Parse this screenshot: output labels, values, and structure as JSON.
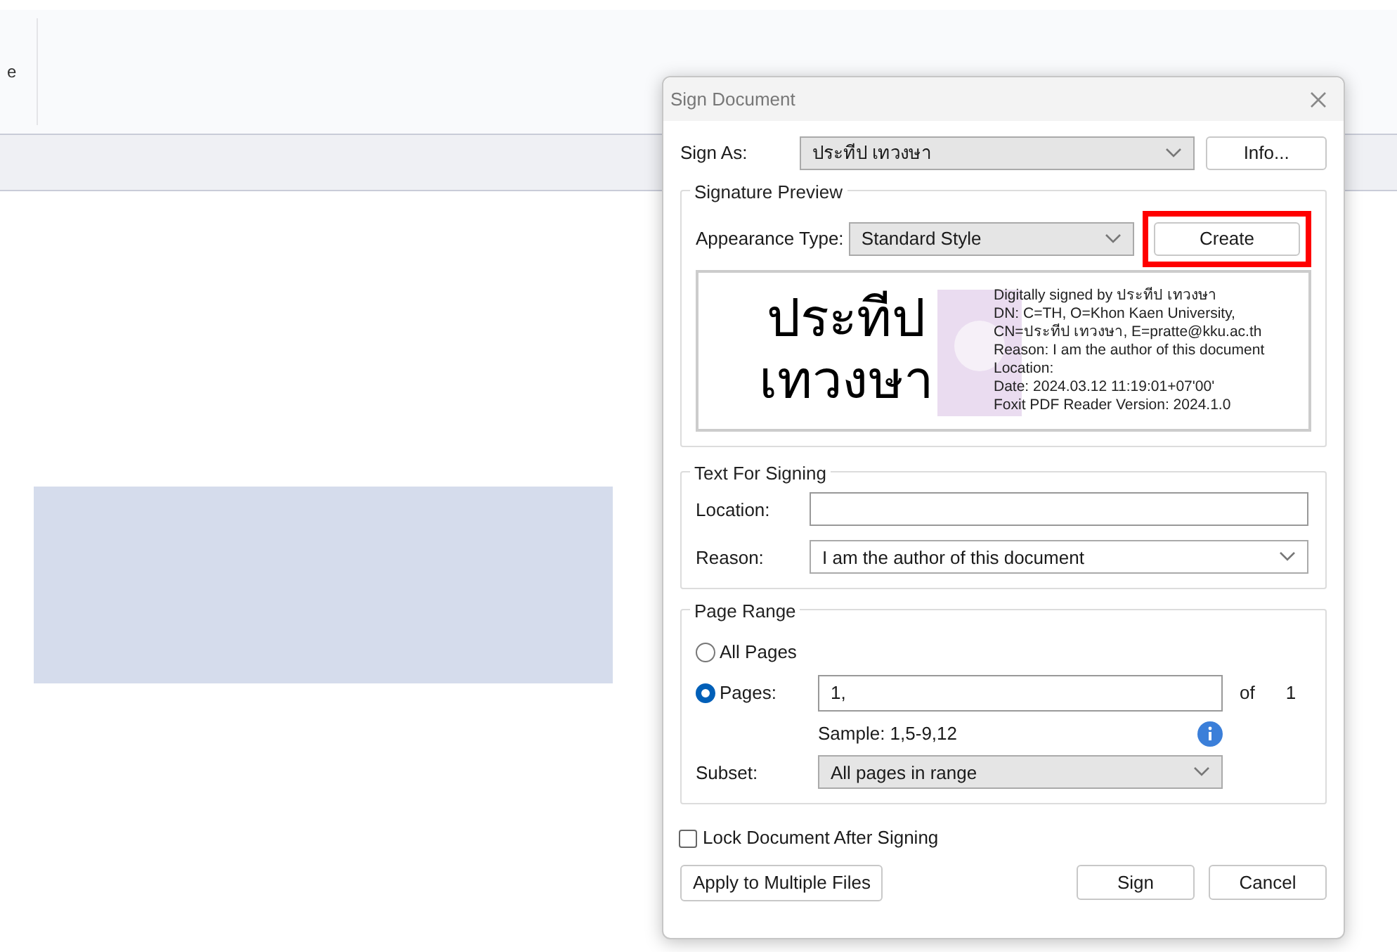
{
  "background": {
    "toolbar_text": "e"
  },
  "dialog": {
    "title": "Sign Document",
    "sign_as": {
      "label": "Sign As:",
      "value": "ประทีป เทวงษา",
      "button": "Info..."
    },
    "signature_preview": {
      "legend": "Signature Preview",
      "appearance_label": "Appearance Type:",
      "appearance_value": "Standard Style",
      "create_button": "Create",
      "create_highlighted": true,
      "name_lines": [
        "ประทีป",
        "เทวงษา"
      ],
      "details": [
        "Digitally signed by ประทีป เทวงษา",
        "DN: C=TH, O=Khon Kaen University,",
        "CN=ประทีป เทวงษา, E=pratte@kku.ac.th",
        "Reason: I am the author of this document",
        "Location:",
        "Date: 2024.03.12 11:19:01+07'00'",
        "Foxit PDF Reader Version: 2024.1.0"
      ]
    },
    "text_for_signing": {
      "legend": "Text For Signing",
      "location_label": "Location:",
      "reason_label": "Reason:",
      "reason_value": "I am the author of this document"
    },
    "page_range": {
      "legend": "Page Range",
      "options": [
        {
          "label": "All Pages",
          "selected": false
        },
        {
          "label": "Pages:",
          "selected": true
        }
      ],
      "pages_value": "1,",
      "of_label": "of",
      "total": "1",
      "sample": "Sample: 1,5-9,12",
      "subset_label": "Subset:",
      "subset_value": "All pages in range"
    },
    "lock": {
      "label": "Lock Document After Signing",
      "checked": false
    },
    "buttons": [
      "Apply to Multiple Files",
      "Sign",
      "Cancel"
    ]
  }
}
